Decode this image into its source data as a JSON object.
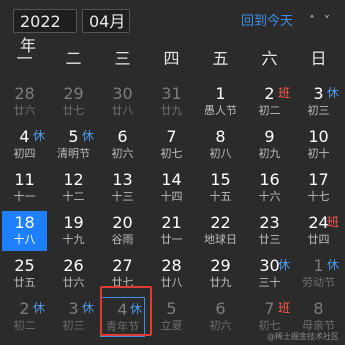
{
  "header": {
    "year": "2022年",
    "month": "04月",
    "today_label": "回到今天",
    "prev_icon": "chevron-up-icon",
    "next_icon": "chevron-down-icon"
  },
  "weekdays": [
    "一",
    "二",
    "三",
    "四",
    "五",
    "六",
    "日"
  ],
  "weeks": [
    [
      {
        "d": "28",
        "s": "廿六",
        "muted": true
      },
      {
        "d": "29",
        "s": "廿七",
        "muted": true
      },
      {
        "d": "30",
        "s": "廿八",
        "muted": true
      },
      {
        "d": "31",
        "s": "廿九",
        "muted": true
      },
      {
        "d": "1",
        "s": "愚人节"
      },
      {
        "d": "2",
        "s": "初二",
        "badge": "班",
        "badge_type": "work"
      },
      {
        "d": "3",
        "s": "初三",
        "badge": "休",
        "badge_type": "rest"
      }
    ],
    [
      {
        "d": "4",
        "s": "初四",
        "badge": "休",
        "badge_type": "rest"
      },
      {
        "d": "5",
        "s": "清明节",
        "badge": "休",
        "badge_type": "rest"
      },
      {
        "d": "6",
        "s": "初六"
      },
      {
        "d": "7",
        "s": "初七"
      },
      {
        "d": "8",
        "s": "初八"
      },
      {
        "d": "9",
        "s": "初九"
      },
      {
        "d": "10",
        "s": "初十"
      }
    ],
    [
      {
        "d": "11",
        "s": "十一"
      },
      {
        "d": "12",
        "s": "十二"
      },
      {
        "d": "13",
        "s": "十三"
      },
      {
        "d": "14",
        "s": "十四"
      },
      {
        "d": "15",
        "s": "十五"
      },
      {
        "d": "16",
        "s": "十六"
      },
      {
        "d": "17",
        "s": "十七"
      }
    ],
    [
      {
        "d": "18",
        "s": "十八",
        "today": true
      },
      {
        "d": "19",
        "s": "十九"
      },
      {
        "d": "20",
        "s": "谷雨"
      },
      {
        "d": "21",
        "s": "廿一"
      },
      {
        "d": "22",
        "s": "地球日"
      },
      {
        "d": "23",
        "s": "廿三"
      },
      {
        "d": "24",
        "s": "廿四",
        "badge": "班",
        "badge_type": "work"
      }
    ],
    [
      {
        "d": "25",
        "s": "廿五"
      },
      {
        "d": "26",
        "s": "廿六"
      },
      {
        "d": "27",
        "s": "廿七"
      },
      {
        "d": "28",
        "s": "廿八"
      },
      {
        "d": "29",
        "s": "廿九"
      },
      {
        "d": "30",
        "s": "三十",
        "badge": "休",
        "badge_type": "rest"
      },
      {
        "d": "1",
        "s": "劳动节",
        "badge": "休",
        "badge_type": "rest",
        "muted": true
      }
    ],
    [
      {
        "d": "2",
        "s": "初二",
        "badge": "休",
        "badge_type": "rest",
        "muted": true
      },
      {
        "d": "3",
        "s": "初三",
        "badge": "休",
        "badge_type": "rest",
        "muted": true
      },
      {
        "d": "4",
        "s": "青年节",
        "badge": "休",
        "badge_type": "rest",
        "muted": true,
        "boxed": true
      },
      {
        "d": "5",
        "s": "立夏",
        "muted": true
      },
      {
        "d": "6",
        "s": "初六",
        "muted": true
      },
      {
        "d": "7",
        "s": "初七",
        "badge": "班",
        "badge_type": "work",
        "muted": true
      },
      {
        "d": "8",
        "s": "母亲节",
        "muted": true
      }
    ]
  ],
  "watermark": "@稀土掘金技术社区",
  "colors": {
    "background": "#2b2b2b",
    "accent": "#1e80ff",
    "rest_badge": "#4e9bf0",
    "work_badge": "#ff5a4a",
    "highlight_box": "#e23b32"
  }
}
